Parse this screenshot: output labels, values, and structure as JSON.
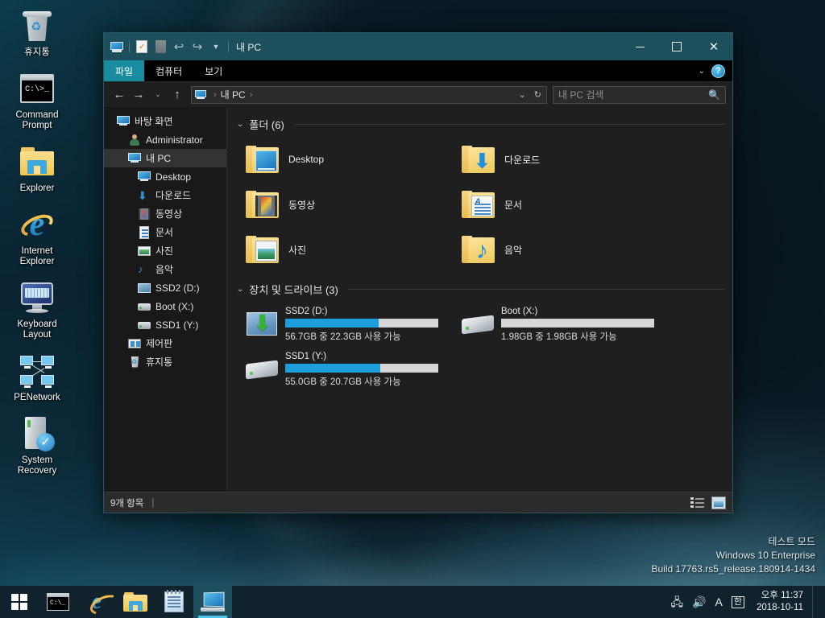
{
  "desktop": {
    "icons": [
      {
        "label": "휴지통",
        "icon": "recycle-bin-icon"
      },
      {
        "label": "Command Prompt",
        "icon": "command-prompt-icon"
      },
      {
        "label": "Explorer",
        "icon": "explorer-folder-icon"
      },
      {
        "label": "Internet Explorer",
        "icon": "internet-explorer-icon"
      },
      {
        "label": "Keyboard Layout",
        "icon": "keyboard-layout-icon"
      },
      {
        "label": "PENetwork",
        "icon": "network-icon"
      },
      {
        "label": "System Recovery",
        "icon": "system-recovery-icon"
      }
    ],
    "watermark": {
      "line1": "테스트 모드",
      "line2": "Windows 10 Enterprise",
      "line3": "Build 17763.rs5_release.180914-1434"
    }
  },
  "window": {
    "title": "내 PC",
    "quick_access": [
      "this-pc-icon",
      "properties-icon",
      "new-folder-icon",
      "undo-icon",
      "redo-icon",
      "customize-dropdown-icon"
    ],
    "controls": {
      "minimize": "−",
      "maximize": "□",
      "close": "✕"
    },
    "ribbon": {
      "tabs": [
        {
          "label": "파일",
          "active": true
        },
        {
          "label": "컴퓨터",
          "active": false
        },
        {
          "label": "보기",
          "active": false
        }
      ],
      "expand_icon": "chevron-down-icon",
      "help_label": "?"
    },
    "nav": {
      "back": "←",
      "forward": "→",
      "recent": "⌄",
      "up": "↑",
      "breadcrumb": [
        "내 PC"
      ],
      "breadcrumb_dropdown": "⌄",
      "refresh": "↻"
    },
    "search": {
      "placeholder": "내 PC 검색",
      "icon": "search-icon"
    },
    "sidebar": {
      "items": [
        {
          "label": "바탕 화면",
          "icon": "desktop-icon",
          "level": 1,
          "selected": false
        },
        {
          "label": "Administrator",
          "icon": "user-icon",
          "level": 2,
          "selected": false
        },
        {
          "label": "내 PC",
          "icon": "this-pc-icon",
          "level": 2,
          "selected": true
        },
        {
          "label": "Desktop",
          "icon": "desktop-icon",
          "level": 3,
          "selected": false
        },
        {
          "label": "다운로드",
          "icon": "downloads-icon",
          "level": 3,
          "selected": false
        },
        {
          "label": "동영상",
          "icon": "videos-icon",
          "level": 3,
          "selected": false
        },
        {
          "label": "문서",
          "icon": "documents-icon",
          "level": 3,
          "selected": false
        },
        {
          "label": "사진",
          "icon": "pictures-icon",
          "level": 3,
          "selected": false
        },
        {
          "label": "음악",
          "icon": "music-icon",
          "level": 3,
          "selected": false
        },
        {
          "label": "SSD2 (D:)",
          "icon": "windows-drive-icon",
          "level": 3,
          "selected": false
        },
        {
          "label": "Boot (X:)",
          "icon": "drive-icon",
          "level": 3,
          "selected": false
        },
        {
          "label": "SSD1 (Y:)",
          "icon": "drive-icon",
          "level": 3,
          "selected": false
        },
        {
          "label": "제어판",
          "icon": "control-panel-icon",
          "level": 2,
          "selected": false
        },
        {
          "label": "휴지통",
          "icon": "recycle-bin-icon",
          "level": 2,
          "selected": false
        }
      ]
    },
    "groups": {
      "folders": {
        "title": "폴더 (6)",
        "items": [
          {
            "label": "Desktop",
            "icon": "folder-desktop-icon"
          },
          {
            "label": "다운로드",
            "icon": "folder-downloads-icon"
          },
          {
            "label": "동영상",
            "icon": "folder-videos-icon"
          },
          {
            "label": "문서",
            "icon": "folder-documents-icon"
          },
          {
            "label": "사진",
            "icon": "folder-pictures-icon"
          },
          {
            "label": "음악",
            "icon": "folder-music-icon"
          }
        ]
      },
      "drives": {
        "title": "장치 및 드라이브 (3)",
        "items": [
          {
            "label": "SSD2 (D:)",
            "free_text": "56.7GB 중 22.3GB 사용 가능",
            "used_percent": 61,
            "icon": "windows-drive-icon"
          },
          {
            "label": "Boot (X:)",
            "free_text": "1.98GB 중 1.98GB 사용 가능",
            "used_percent": 0,
            "icon": "drive-icon"
          },
          {
            "label": "SSD1 (Y:)",
            "free_text": "55.0GB 중 20.7GB 사용 가능",
            "used_percent": 62,
            "icon": "drive-icon"
          }
        ]
      }
    },
    "status": {
      "item_count": "9개 항목",
      "separator": "|",
      "view_details": "details-view-icon",
      "view_tiles": "large-icons-view-icon"
    }
  },
  "taskbar": {
    "start": "start-button",
    "items": [
      {
        "name": "command-prompt",
        "active": false
      },
      {
        "name": "internet-explorer",
        "active": false
      },
      {
        "name": "file-explorer",
        "active": false
      },
      {
        "name": "notepad",
        "active": false
      },
      {
        "name": "this-pc-window",
        "active": true
      }
    ],
    "tray": {
      "network": "network-icon",
      "volume": "volume-icon",
      "ime_a": "A",
      "ime_ko": "한",
      "time": "오후 11:37",
      "date": "2018-10-11"
    }
  }
}
